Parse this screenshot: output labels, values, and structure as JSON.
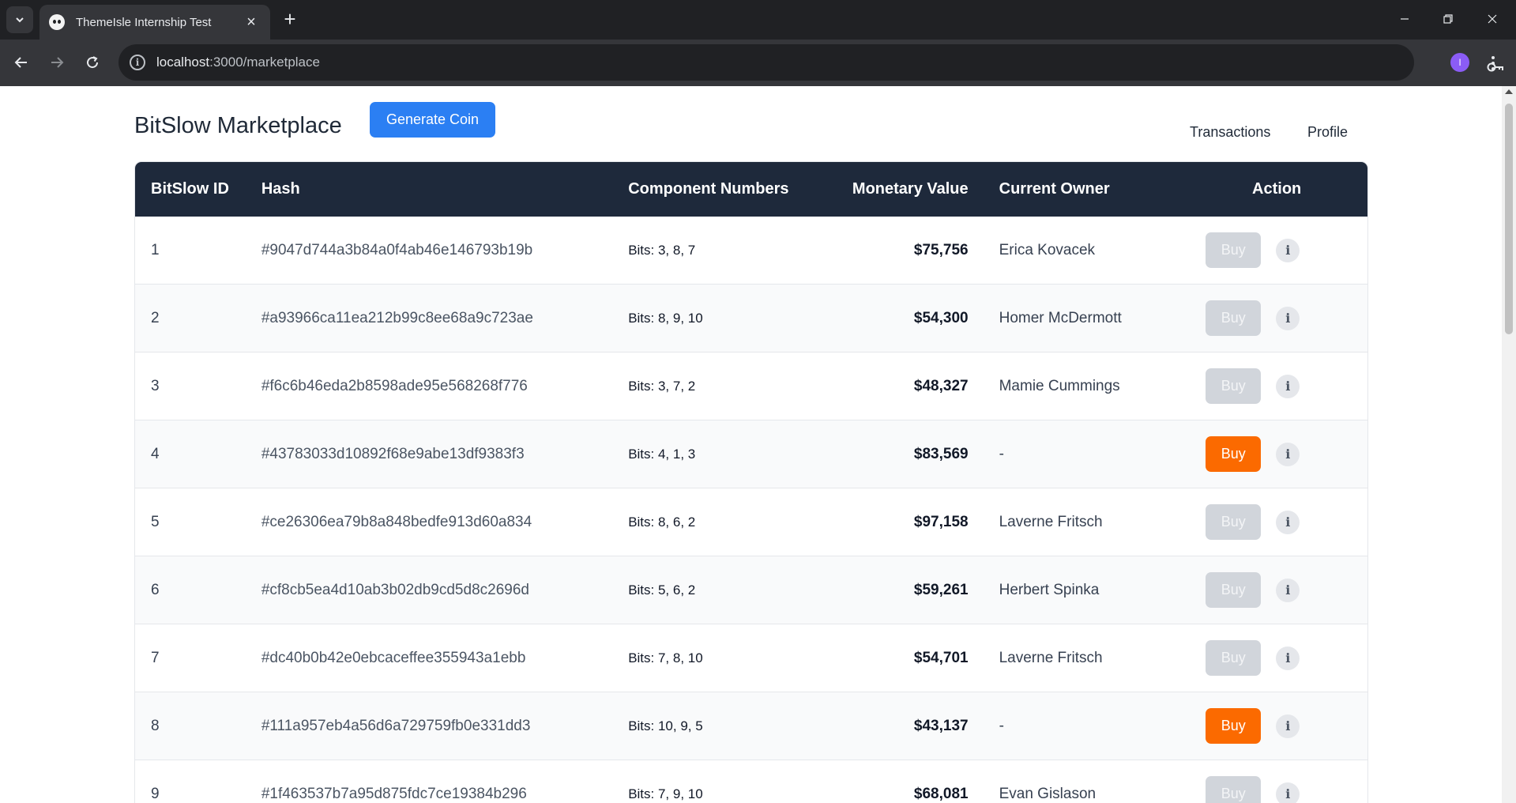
{
  "browser": {
    "tab_title": "ThemeIsle Internship Test",
    "url_host": "localhost",
    "url_path": ":3000/marketplace",
    "avatar_letter": "I",
    "icons": [
      "chevron-down-icon",
      "favicon-icon",
      "close-icon",
      "plus-icon",
      "minimize-icon",
      "restore-icon",
      "window-close-icon",
      "back-icon",
      "forward-icon",
      "reload-icon",
      "site-info-icon",
      "key-icon",
      "star-icon",
      "menu-icon"
    ]
  },
  "header": {
    "title": "BitSlow Marketplace",
    "generate_button": "Generate Coin",
    "nav_transactions": "Transactions",
    "nav_profile": "Profile"
  },
  "colors": {
    "table_header_bg": "#1e293b",
    "primary_button": "#2b7ff3",
    "buy_active": "#fb6a00",
    "buy_disabled": "#d1d5db"
  },
  "table": {
    "columns": [
      "BitSlow ID",
      "Hash",
      "Component Numbers",
      "Monetary Value",
      "Current Owner",
      "Action"
    ],
    "rows": [
      {
        "id": "1",
        "hash": "#9047d744a3b84a0f4ab46e146793b19b",
        "components": "Bits: 3, 8, 7",
        "value": "$75,756",
        "owner": "Erica Kovacek",
        "buy_label": "Buy",
        "buy_enabled": false,
        "info_label": "i"
      },
      {
        "id": "2",
        "hash": "#a93966ca11ea212b99c8ee68a9c723ae",
        "components": "Bits: 8, 9, 10",
        "value": "$54,300",
        "owner": "Homer McDermott",
        "buy_label": "Buy",
        "buy_enabled": false,
        "info_label": "i"
      },
      {
        "id": "3",
        "hash": "#f6c6b46eda2b8598ade95e568268f776",
        "components": "Bits: 3, 7, 2",
        "value": "$48,327",
        "owner": "Mamie Cummings",
        "buy_label": "Buy",
        "buy_enabled": false,
        "info_label": "i"
      },
      {
        "id": "4",
        "hash": "#43783033d10892f68e9abe13df9383f3",
        "components": "Bits: 4, 1, 3",
        "value": "$83,569",
        "owner": "-",
        "buy_label": "Buy",
        "buy_enabled": true,
        "info_label": "i"
      },
      {
        "id": "5",
        "hash": "#ce26306ea79b8a848bedfe913d60a834",
        "components": "Bits: 8, 6, 2",
        "value": "$97,158",
        "owner": "Laverne Fritsch",
        "buy_label": "Buy",
        "buy_enabled": false,
        "info_label": "i"
      },
      {
        "id": "6",
        "hash": "#cf8cb5ea4d10ab3b02db9cd5d8c2696d",
        "components": "Bits: 5, 6, 2",
        "value": "$59,261",
        "owner": "Herbert Spinka",
        "buy_label": "Buy",
        "buy_enabled": false,
        "info_label": "i"
      },
      {
        "id": "7",
        "hash": "#dc40b0b42e0ebcaceffee355943a1ebb",
        "components": "Bits: 7, 8, 10",
        "value": "$54,701",
        "owner": "Laverne Fritsch",
        "buy_label": "Buy",
        "buy_enabled": false,
        "info_label": "i"
      },
      {
        "id": "8",
        "hash": "#111a957eb4a56d6a729759fb0e331dd3",
        "components": "Bits: 10, 9, 5",
        "value": "$43,137",
        "owner": "-",
        "buy_label": "Buy",
        "buy_enabled": true,
        "info_label": "i"
      },
      {
        "id": "9",
        "hash": "#1f463537b7a95d875fdc7ce19384b296",
        "components": "Bits: 7, 9, 10",
        "value": "$68,081",
        "owner": "Evan Gislason",
        "buy_label": "Buy",
        "buy_enabled": false,
        "info_label": "i"
      }
    ]
  }
}
